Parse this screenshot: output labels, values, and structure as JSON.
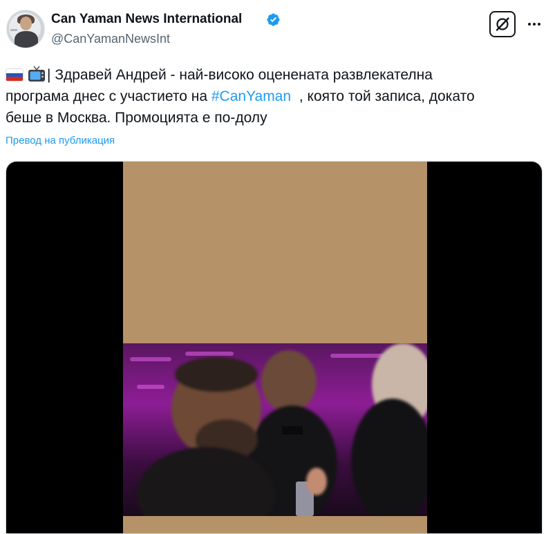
{
  "author": {
    "name": "Can Yaman News International",
    "handle": "@CanYamanNewsInt",
    "verified": true
  },
  "actions": {
    "grok_icon": "grok-icon",
    "more_icon": "more-dots-icon"
  },
  "tweet": {
    "line1_text": "Здравей Андрей - най-високо оценената развлекателна",
    "line2_before": "програма днес с участието на ",
    "line2_hashtag": "#CanYaman",
    "line2_after": " , която той записа, докато",
    "line3_text": "беше в Москва. Промоцията е по-долу",
    "emoji_flag": "russia-flag",
    "emoji_tv": "television-emoji",
    "separator": "|"
  },
  "translate_link": "Превод на публикация",
  "colors": {
    "accent": "#1d9bf0",
    "secondary_text": "#536471",
    "video_letterbox": "#b59268"
  }
}
